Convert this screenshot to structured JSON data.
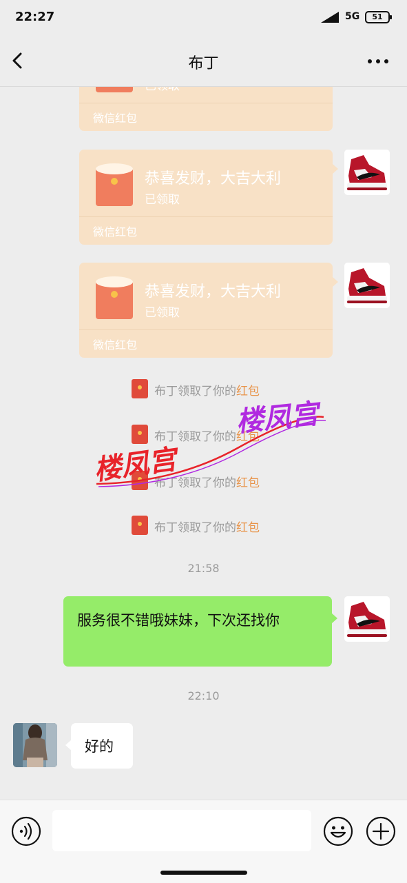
{
  "status_bar": {
    "time": "22:27",
    "network": "5G",
    "battery": "51"
  },
  "nav": {
    "title": "布丁"
  },
  "red_packets": [
    {
      "title": "",
      "status": "已领取",
      "label": "微信红包"
    },
    {
      "title": "恭喜发财，大吉大利",
      "status": "已领取",
      "label": "微信红包"
    },
    {
      "title": "恭喜发财，大吉大利",
      "status": "已领取",
      "label": "微信红包"
    }
  ],
  "notices": [
    {
      "text": "布丁领取了你的",
      "link": "红包"
    },
    {
      "text": "布丁领取了你的",
      "link": "红包"
    },
    {
      "text": "布丁领取了你的",
      "link": "红包"
    },
    {
      "text": "布丁领取了你的",
      "link": "红包"
    }
  ],
  "timestamps": [
    "21:58",
    "22:10"
  ],
  "messages": {
    "sent": "服务很不错哦妹妹，下次还找你",
    "received": "好的"
  },
  "watermark": {
    "text1": "楼凤宫",
    "text2": "楼凤宫"
  },
  "input": {
    "value": ""
  },
  "colors": {
    "bubble_green": "#95EC69",
    "red_packet": "#F8E1C6",
    "link": "#E8944A",
    "watermark_red": "#E8232A",
    "watermark_purple": "#B02AE0"
  }
}
